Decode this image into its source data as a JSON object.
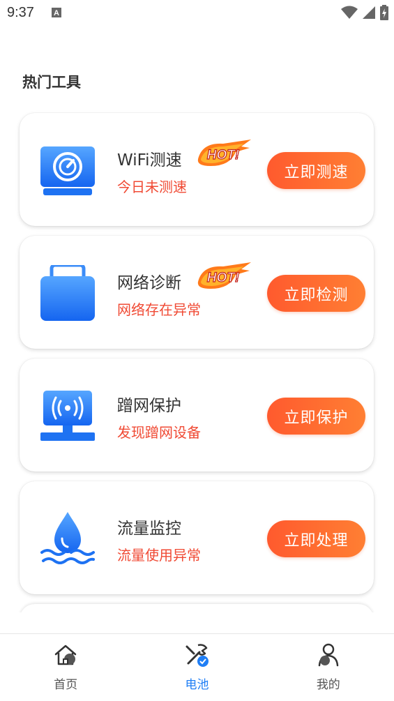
{
  "status_bar": {
    "time": "9:37"
  },
  "section_title": "热门工具",
  "tools": [
    {
      "title": "WiFi测速",
      "subtitle": "今日未测速",
      "hot": true,
      "button_label": "立即测速",
      "icon": "wifi-speed-monitor-icon"
    },
    {
      "title": "网络诊断",
      "subtitle": "网络存在异常",
      "hot": true,
      "button_label": "立即检测",
      "icon": "toolbox-icon"
    },
    {
      "title": "蹭网保护",
      "subtitle": "发现蹭网设备",
      "hot": false,
      "button_label": "立即保护",
      "icon": "signal-monitor-icon"
    },
    {
      "title": "流量监控",
      "subtitle": "流量使用异常",
      "hot": false,
      "button_label": "立即处理",
      "icon": "water-drop-icon"
    }
  ],
  "hot_badge_text": "HOT!",
  "nav": {
    "items": [
      {
        "label": "首页",
        "icon": "home-icon",
        "active": false
      },
      {
        "label": "电池",
        "icon": "tools-icon",
        "active": true
      },
      {
        "label": "我的",
        "icon": "user-icon",
        "active": false
      }
    ]
  },
  "colors": {
    "accent_blue": "#1f7ef5",
    "button_gradient_start": "#ff5a2e",
    "button_gradient_end": "#ff7f33",
    "alert_red": "#f04a34"
  }
}
